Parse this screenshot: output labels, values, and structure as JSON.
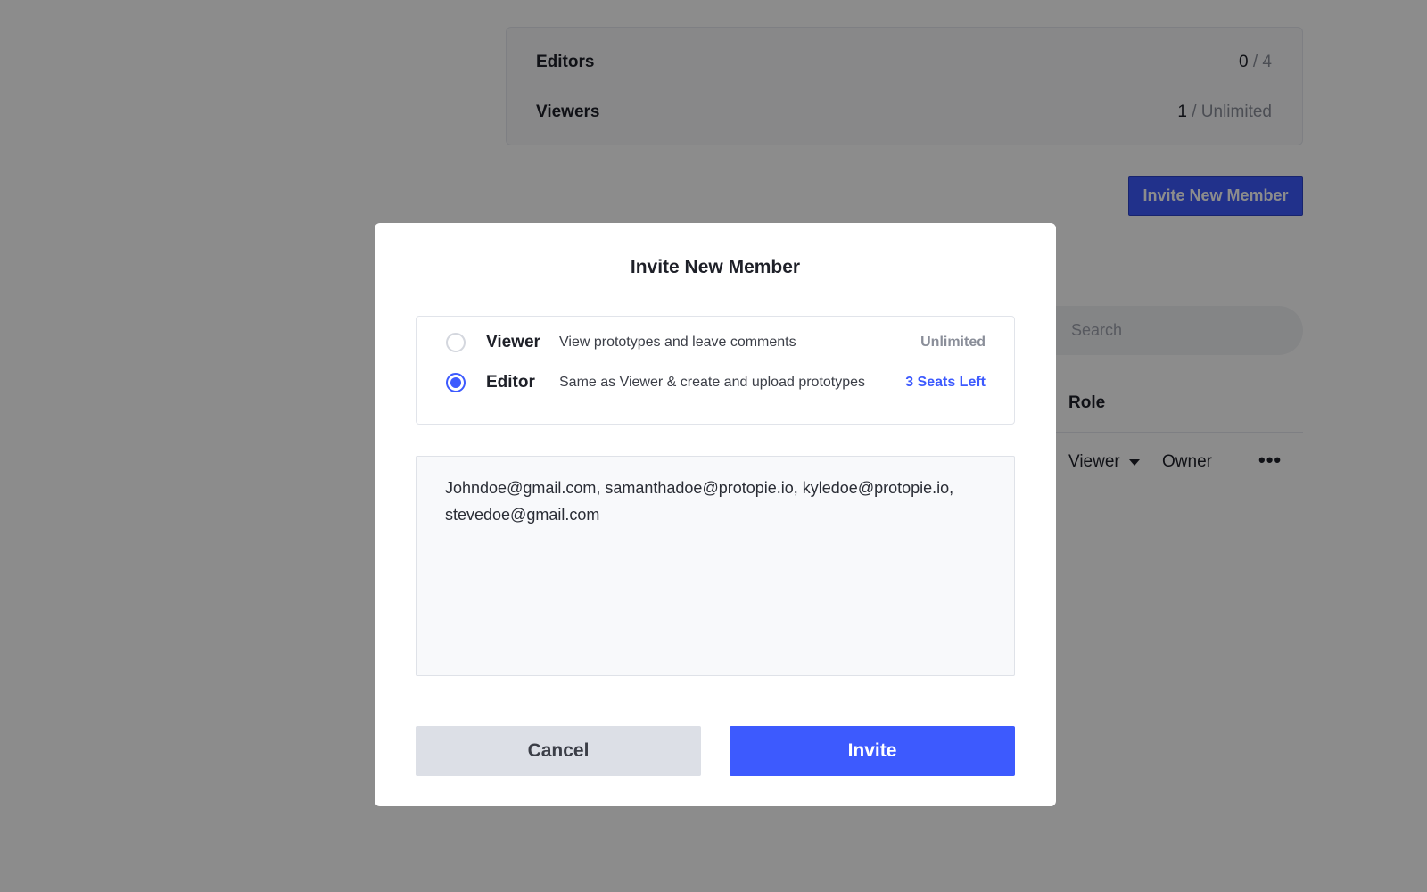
{
  "background": {
    "seats": [
      {
        "label": "Editors",
        "count": "0",
        "separator": "/",
        "limit": "4"
      },
      {
        "label": "Viewers",
        "count": "1",
        "separator": "/",
        "limit": "Unlimited"
      }
    ],
    "invite_button_label": "Invite New Member",
    "search_placeholder": "Search",
    "table": {
      "role_header": "Role",
      "row": {
        "role": "Viewer",
        "type": "Owner",
        "more": "•••"
      }
    }
  },
  "modal": {
    "title": "Invite New Member",
    "roles": [
      {
        "name": "Viewer",
        "description": "View prototypes and leave comments",
        "seats": "Unlimited",
        "selected": false
      },
      {
        "name": "Editor",
        "description": "Same as Viewer & create and upload prototypes",
        "seats": "3 Seats Left",
        "selected": true
      }
    ],
    "emails": "Johndoe@gmail.com, samanthadoe@protopie.io, kyledoe@protopie.io, stevedoe@gmail.com",
    "cancel_label": "Cancel",
    "invite_label": "Invite"
  },
  "colors": {
    "accent": "#3d5afe",
    "overlay": "rgba(0,0,0,0.45)",
    "cancel_bg": "#dcdfe6"
  }
}
